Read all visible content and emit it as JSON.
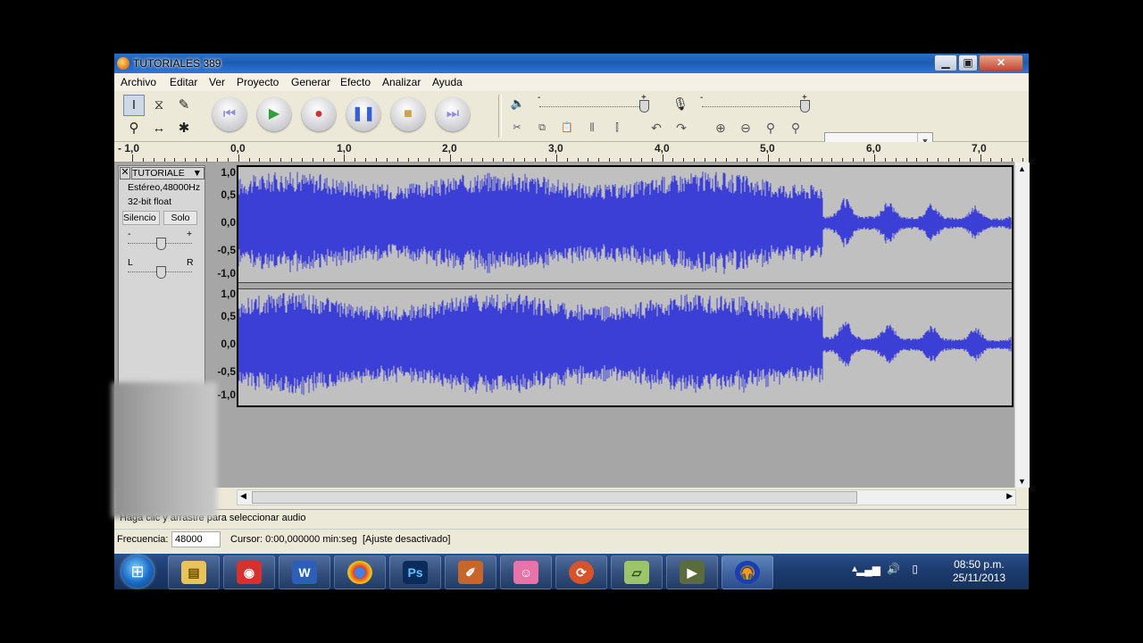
{
  "window": {
    "title": "TUTORIALES 389"
  },
  "menu": [
    "Archivo",
    "Editar",
    "Ver",
    "Proyecto",
    "Generar",
    "Efecto",
    "Analizar",
    "Ayuda"
  ],
  "meter_marks": {
    "minus": "-",
    "plus": "+"
  },
  "ruler_ticks": [
    "- 1,0",
    "0,0",
    "1,0",
    "2,0",
    "3,0",
    "4,0",
    "5,0",
    "6,0",
    "7,0"
  ],
  "track": {
    "name": "TUTORIALE",
    "info": "Estéreo,48000Hz",
    "format": "32-bit float",
    "mute_label": "Silencio",
    "solo_label": "Solo",
    "gain_minus": "-",
    "gain_plus": "+",
    "pan_left": "L",
    "pan_right": "R",
    "y_ticks": [
      "1,0",
      "0,5",
      "0,0",
      "-0,5",
      "-1,0"
    ]
  },
  "status": {
    "hint": "Haga clic y arrastre para seleccionar audio",
    "freq_label": "Frecuencia:",
    "freq_value": "48000",
    "cursor": "Cursor: 0:00,000000 min:seg",
    "snap": "[Ajuste desactivado]"
  },
  "taskbar": {
    "apps": [
      "explorer-icon",
      "media-recorder-icon",
      "word-icon",
      "chrome-icon",
      "photoshop-icon",
      "editor-icon",
      "photo-icon",
      "refresh-app-icon",
      "notes-icon",
      "camera-icon",
      "audacity-icon"
    ],
    "time": "08:50 p.m.",
    "date": "25/11/2013"
  },
  "colors": {
    "wave": "#3c3fd6",
    "titlebar": "#1d5cb0"
  }
}
